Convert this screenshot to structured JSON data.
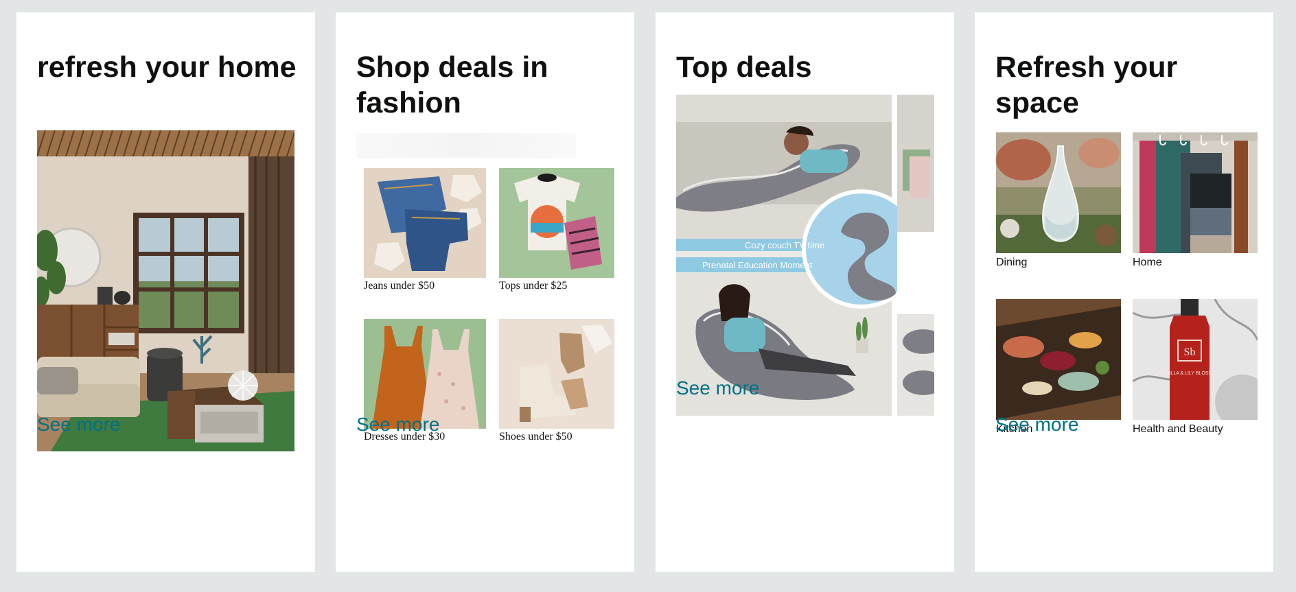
{
  "cards": [
    {
      "title": "refresh your home",
      "see_more": "See more"
    },
    {
      "title": "Shop deals in fashion",
      "tiles": [
        {
          "label": "Jeans under $50"
        },
        {
          "label": "Tops under $25"
        },
        {
          "label": "Dresses under $30"
        },
        {
          "label": "Shoes under $50"
        }
      ],
      "see_more": "See more"
    },
    {
      "title": "Top deals",
      "banner": {
        "line1": "Cozy couch TV time",
        "line2": "Prenatal Education Moment"
      },
      "see_more": "See more"
    },
    {
      "title": "Refresh your space",
      "tiles": [
        {
          "label": "Dining"
        },
        {
          "label": "Home"
        },
        {
          "label": "Kitchen"
        },
        {
          "label": "Health and Beauty",
          "bottle_text": "VANILLA & LILY BLOSSOM",
          "bottle_brand": "Sb"
        }
      ],
      "see_more": "See more"
    }
  ],
  "colors": {
    "page_bg": "#e3e6e6",
    "card_bg": "#ffffff",
    "link": "#007185",
    "heading": "#0f1111"
  }
}
